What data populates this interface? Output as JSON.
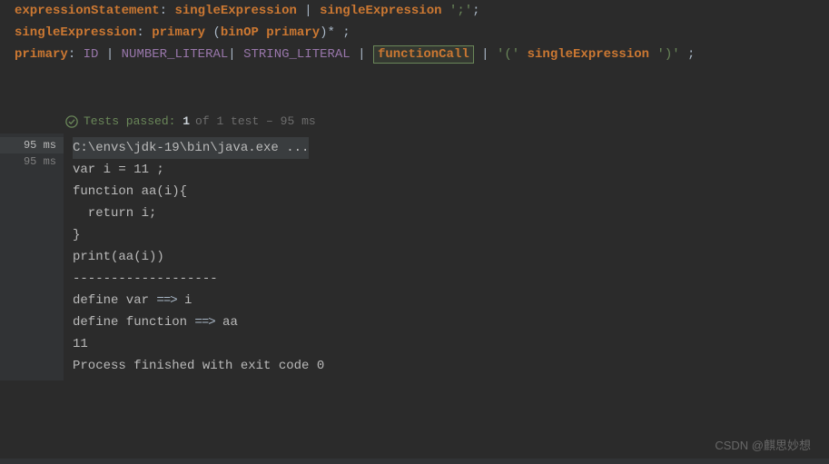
{
  "grammar": {
    "line1": {
      "rule": "expressionStatement",
      "rhs_a": "singleExpression",
      "rhs_b": "singleExpression",
      "semi": "';'",
      "trailing": ";"
    },
    "line2": {
      "rule": "singleExpression",
      "rhs_a": "primary",
      "lparen": "(",
      "rhs_b": "binOP",
      "rhs_c": "primary",
      "rparen_star": ")*",
      "trailing": " ;"
    },
    "line3": {
      "rule": "primary",
      "id": "ID",
      "num": "NUMBER_LITERAL",
      "str": "STRING_LITERAL",
      "fcall": "functionCall",
      "lp": "'('",
      "se": "singleExpression",
      "rp": "')'",
      "trailing": " ;"
    }
  },
  "tests": {
    "label": "Tests passed:",
    "count": "1",
    "extra": "of 1 test – 95 ms"
  },
  "gutter": {
    "total": "95 ms",
    "item": "95 ms"
  },
  "console": {
    "cmd": "C:\\envs\\jdk-19\\bin\\java.exe ...",
    "l1": "var i = 11 ;",
    "l2": "",
    "l3": "function aa(i){",
    "l4": "  return i;",
    "l5": "}",
    "l6": "",
    "l7": "print(aa(i))",
    "l8": "-------------------",
    "l9_a": "define var ",
    "l9_arrow": "==>",
    "l9_b": " i",
    "l10_a": "define function ",
    "l10_arrow": "==>",
    "l10_b": " aa",
    "l11": "11",
    "l12": "Process finished with exit code 0"
  },
  "watermark": "CSDN @麒思妙想"
}
